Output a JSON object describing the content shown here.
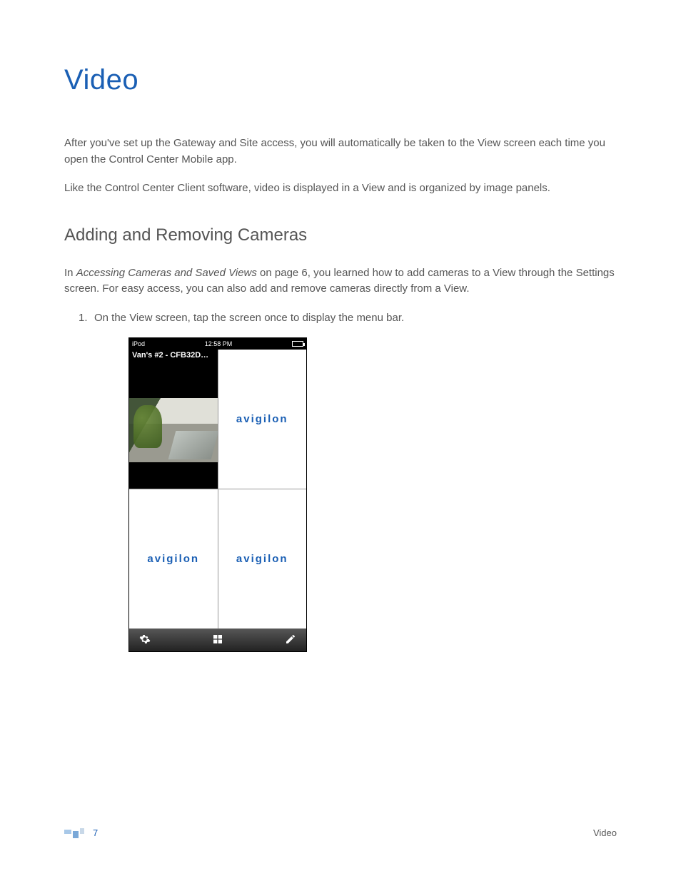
{
  "title": "Video",
  "paragraphs": {
    "p1": "After you've set up the Gateway and Site access, you will automatically be taken to the View screen each time you open the Control Center Mobile app.",
    "p2": "Like the Control Center Client software, video is displayed in a View and is organized by image panels."
  },
  "subhead": "Adding and Removing Cameras",
  "paragraphs2": {
    "p3a": "In ",
    "p3_em": "Accessing Cameras and Saved Views",
    "p3b": " on page 6, you learned how to add cameras to a View through the Settings screen. For easy access, you can also add and remove cameras directly from a View."
  },
  "steps": {
    "s1_num": "1.",
    "s1": "On the View screen, tap the screen once to display the menu bar."
  },
  "phone": {
    "status_left": "iPod",
    "status_time": "12:58 PM",
    "camera_label": "Van's #2 - CFB32D…",
    "brand": "avigilon",
    "icons": {
      "settings": "gear-icon",
      "layout": "grid-icon",
      "edit": "pencil-icon"
    }
  },
  "footer": {
    "page": "7",
    "section": "Video"
  }
}
